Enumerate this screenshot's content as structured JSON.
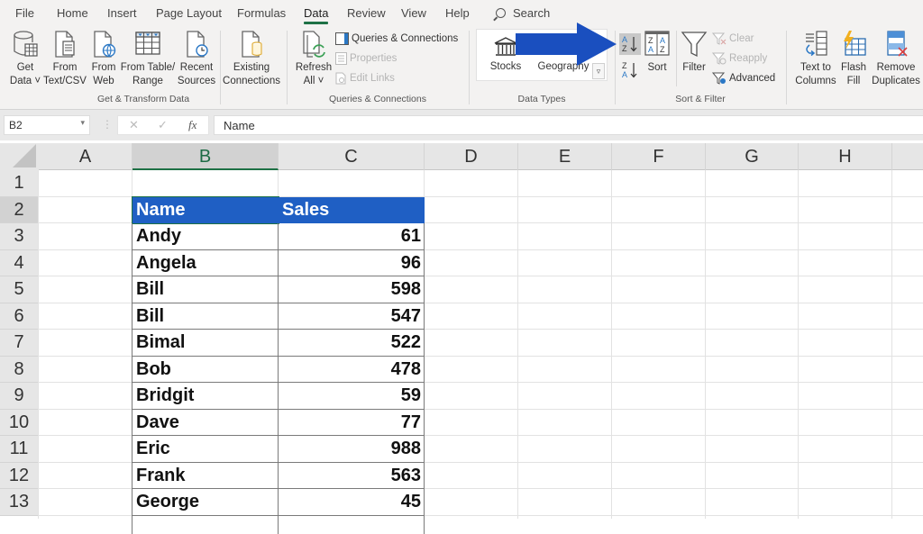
{
  "ribbon": {
    "tabs": [
      "File",
      "Home",
      "Insert",
      "Page Layout",
      "Formulas",
      "Data",
      "Review",
      "View",
      "Help"
    ],
    "active_tab": "Data",
    "search_label": "Search",
    "groups": {
      "get_transform": {
        "label": "Get & Transform Data",
        "buttons": [
          {
            "line1": "Get",
            "line2": "Data ˅"
          },
          {
            "line1": "From",
            "line2": "Text/CSV"
          },
          {
            "line1": "From",
            "line2": "Web"
          },
          {
            "line1": "From Table/",
            "line2": "Range"
          },
          {
            "line1": "Recent",
            "line2": "Sources"
          },
          {
            "line1": "Existing",
            "line2": "Connections"
          }
        ]
      },
      "queries": {
        "label": "Queries & Connections",
        "refresh": {
          "line1": "Refresh",
          "line2": "All ˅"
        },
        "queries_connections": "Queries & Connections",
        "properties": "Properties",
        "edit_links": "Edit Links"
      },
      "data_types": {
        "label": "Data Types",
        "stocks": "Stocks",
        "geography": "Geography"
      },
      "sort_filter": {
        "label": "Sort & Filter",
        "sort": "Sort",
        "filter": "Filter",
        "clear": "Clear",
        "reapply": "Reapply",
        "advanced": "Advanced",
        "sort_az_glyph": "A\nZ",
        "sort_za_glyph": "Z\nA"
      },
      "data_tools": {
        "text_to_columns": {
          "line1": "Text to",
          "line2": "Columns"
        },
        "flash_fill": {
          "line1": "Flash",
          "line2": "Fill"
        },
        "remove_duplicates": {
          "line1": "Remove",
          "line2": "Duplicates"
        }
      }
    }
  },
  "formula_bar": {
    "name_box": "B2",
    "cancel_glyph": "✕",
    "enter_glyph": "✓",
    "fx_glyph": "fx",
    "value": "Name"
  },
  "sheet": {
    "columns": [
      "A",
      "B",
      "C",
      "D",
      "E",
      "F",
      "G",
      "H"
    ],
    "selected_column": "B",
    "rows": [
      "1",
      "2",
      "3",
      "4",
      "5",
      "6",
      "7",
      "8",
      "9",
      "10",
      "11",
      "12",
      "13"
    ],
    "selected_row": "2",
    "table": {
      "headers": [
        "Name",
        "Sales"
      ],
      "header_color": "#1f5fc4",
      "records": [
        {
          "name": "Andy",
          "sales": "61"
        },
        {
          "name": "Angela",
          "sales": "96"
        },
        {
          "name": "Bill",
          "sales": "598"
        },
        {
          "name": "Bill",
          "sales": "547"
        },
        {
          "name": "Bimal",
          "sales": "522"
        },
        {
          "name": "Bob",
          "sales": "478"
        },
        {
          "name": "Bridgit",
          "sales": "59"
        },
        {
          "name": "Dave",
          "sales": "77"
        },
        {
          "name": "Eric",
          "sales": "988"
        },
        {
          "name": "Frank",
          "sales": "563"
        },
        {
          "name": "George",
          "sales": "45"
        }
      ]
    }
  },
  "annotation": {
    "arrow_color": "#1a4fbf",
    "points_to": "sort-ascending-button"
  }
}
